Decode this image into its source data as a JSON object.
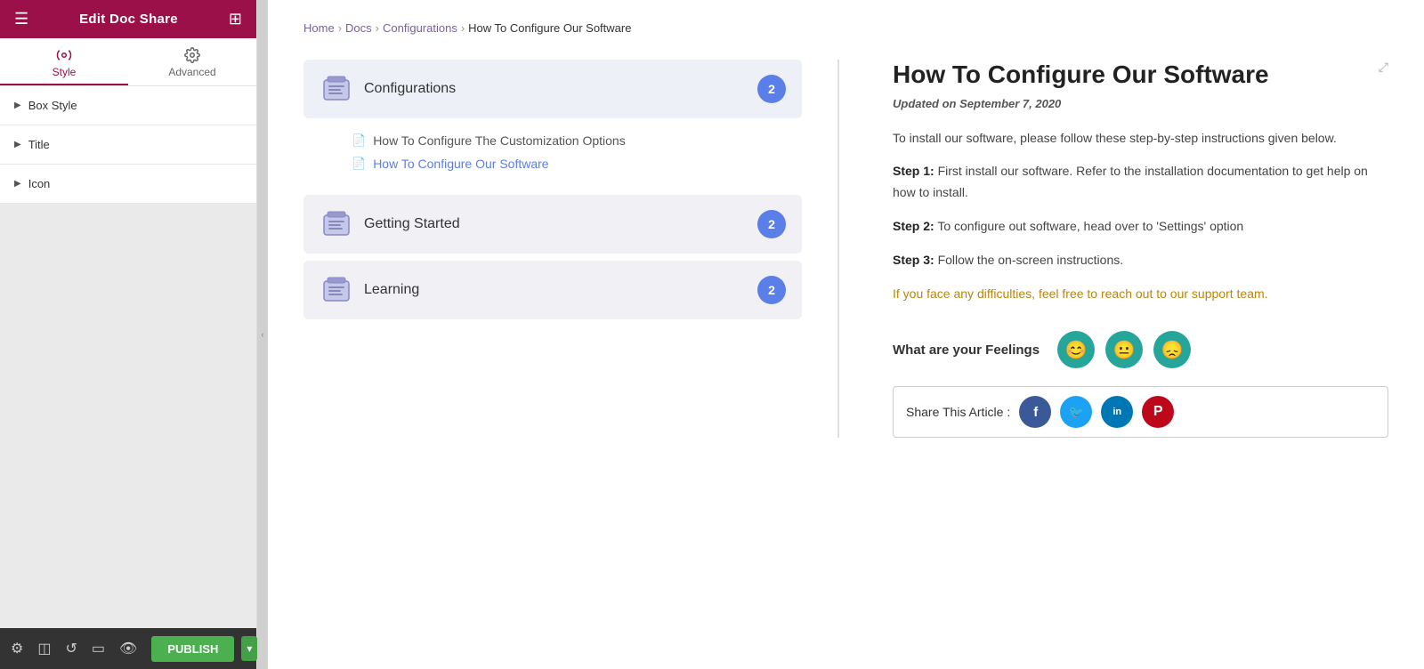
{
  "sidebar": {
    "header": {
      "title": "Edit Doc Share",
      "hamburger": "☰",
      "grid": "⊞"
    },
    "tabs": [
      {
        "id": "style",
        "label": "Style",
        "active": true
      },
      {
        "id": "advanced",
        "label": "Advanced",
        "active": false
      }
    ],
    "sections": [
      {
        "id": "box-style",
        "label": "Box Style"
      },
      {
        "id": "title",
        "label": "Title"
      },
      {
        "id": "icon",
        "label": "Icon"
      }
    ],
    "bottom": {
      "publish_label": "PUBLISH"
    }
  },
  "breadcrumb": {
    "items": [
      "Home",
      "Docs",
      "Configurations",
      "How To Configure Our Software"
    ],
    "separators": [
      ">",
      ">",
      ">"
    ]
  },
  "doc_list": {
    "categories": [
      {
        "id": "configurations",
        "title": "Configurations",
        "badge": "2",
        "subitems": [
          {
            "label": "How To Configure The Customization Options",
            "active": false
          },
          {
            "label": "How To Configure Our Software",
            "active": true
          }
        ]
      },
      {
        "id": "getting-started",
        "title": "Getting Started",
        "badge": "2",
        "subitems": []
      },
      {
        "id": "learning",
        "title": "Learning",
        "badge": "2",
        "subitems": []
      }
    ]
  },
  "article": {
    "title": "How To Configure Our Software",
    "date": "Updated on September 7, 2020",
    "intro": "To install our software, please follow these step-by-step instructions given below.",
    "steps": [
      {
        "label": "Step 1:",
        "text": " First install our software. Refer to the installation documentation to get help on how to install."
      },
      {
        "label": "Step 2:",
        "text": " To configure out software, head over to 'Settings' option"
      },
      {
        "label": "Step 3:",
        "text": " Follow the on-screen instructions."
      }
    ],
    "note": "If you face any difficulties, feel free to reach out to our support team.",
    "feelings": {
      "label": "What are your Feelings",
      "buttons": [
        "😊",
        "😐",
        "😞"
      ]
    },
    "share": {
      "label": "Share This Article :",
      "socials": [
        {
          "name": "facebook",
          "symbol": "f",
          "class": "social-fb"
        },
        {
          "name": "twitter",
          "symbol": "t",
          "class": "social-tw"
        },
        {
          "name": "linkedin",
          "symbol": "in",
          "class": "social-li"
        },
        {
          "name": "pinterest",
          "symbol": "P",
          "class": "social-pi"
        }
      ]
    }
  }
}
